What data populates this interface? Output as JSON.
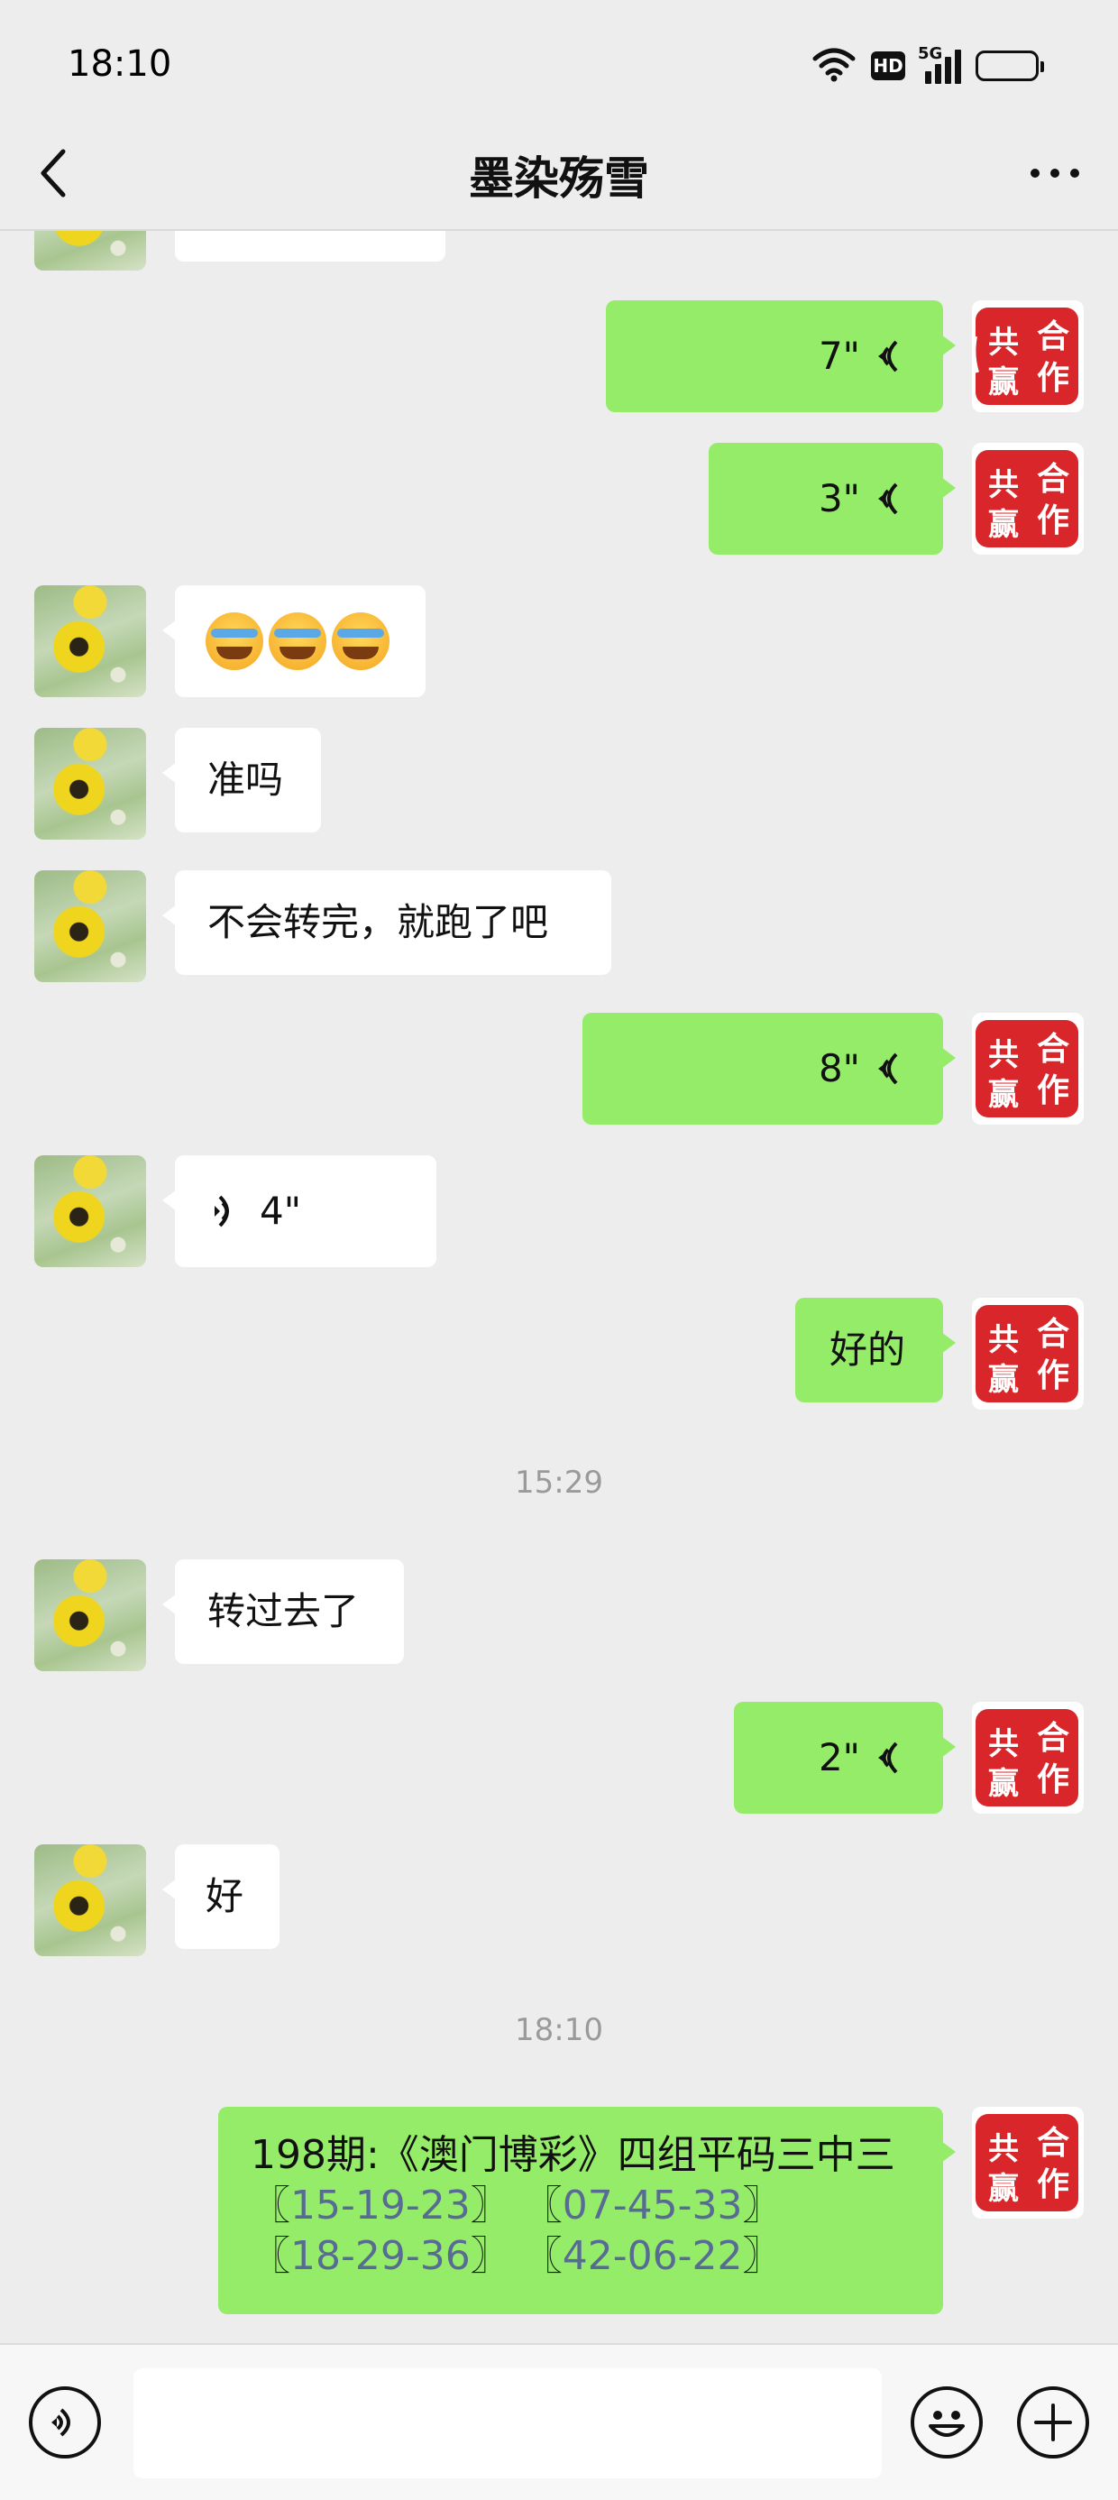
{
  "status_bar": {
    "time": "18:10",
    "network_label": "5G",
    "hd_label": "HD",
    "icons": [
      "wifi-icon",
      "hd-icon",
      "signal-icon",
      "battery-icon"
    ]
  },
  "nav": {
    "title": "墨染殇雪",
    "back_icon": "chevron-left-icon",
    "more_icon": "more-dots-icon"
  },
  "messages": {
    "m1": {
      "duration": "7\""
    },
    "m2": {
      "duration": "3\""
    },
    "m3": {
      "emoji": [
        "face-tears-icon",
        "face-tears-icon",
        "face-tears-icon"
      ]
    },
    "m4": {
      "text": "准吗"
    },
    "m5": {
      "text": "不会转完，就跑了吧"
    },
    "m6": {
      "duration": "8\""
    },
    "m7": {
      "duration": "4\""
    },
    "m8": {
      "text": "好的"
    },
    "ts1": "15:29",
    "m9": {
      "text": "转过去了"
    },
    "m10": {
      "duration": "2\""
    },
    "m11": {
      "text": "好"
    },
    "ts2": "18:10",
    "m12": {
      "line1": "198期:《澳门博彩》四组平码三中三",
      "g1_open": "〖",
      "g1": "15-19-23",
      "g1_close": "〗",
      "g2_open": "〖",
      "g2": "07-45-33",
      "g2_close": "〗",
      "g3_open": "〖",
      "g3": "18-29-36",
      "g3_close": "〗",
      "g4_open": "〖",
      "g4": "42-06-22",
      "g4_close": "〗"
    }
  },
  "seal_avatar": {
    "text_1": "合",
    "text_2": "作",
    "text_3": "共",
    "text_4": "赢"
  },
  "input_bar": {
    "voice_icon": "voice-mode-icon",
    "input_value": "",
    "emoji_icon": "emoji-icon",
    "plus_icon": "plus-icon"
  },
  "colors": {
    "bubble_sent": "#95ec69",
    "bubble_received": "#ffffff",
    "background": "#ededed",
    "link": "#576b95"
  }
}
